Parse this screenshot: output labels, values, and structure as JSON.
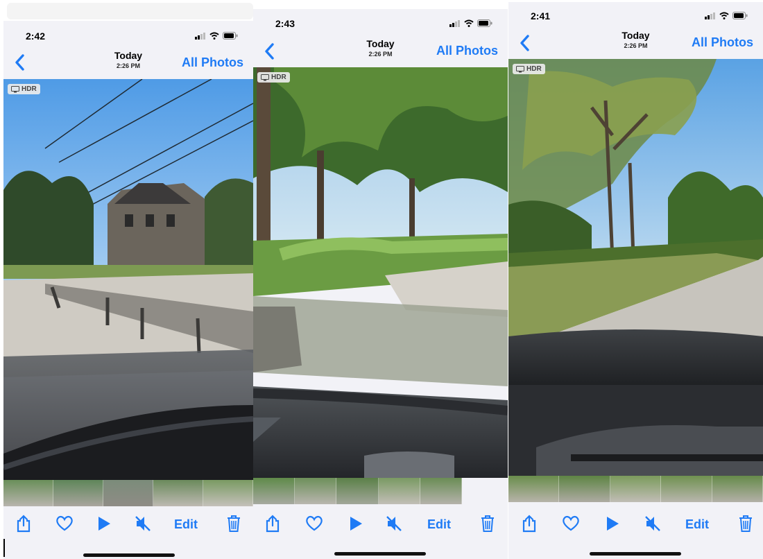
{
  "colors": {
    "accent": "#1f7bf5",
    "icon_blue": "#1f7bf5",
    "sky": "#6fb3ee",
    "grass": "#7a9a4a",
    "road": "#c9c6c0",
    "dash": "#2a2c30"
  },
  "screens": [
    {
      "status_time": "2:42",
      "nav": {
        "title": "Today",
        "subtitle": "2:26 PM",
        "right_link": "All Photos"
      },
      "badge": "HDR",
      "toolbar": {
        "edit": "Edit"
      },
      "icons": [
        "share-icon",
        "heart-icon",
        "play-icon",
        "mute-icon",
        "trash-icon"
      ]
    },
    {
      "status_time": "2:43",
      "nav": {
        "title": "Today",
        "subtitle": "2:26 PM",
        "right_link": "All Photos"
      },
      "badge": "HDR",
      "toolbar": {
        "edit": "Edit"
      },
      "icons": [
        "share-icon",
        "heart-icon",
        "play-icon",
        "mute-icon",
        "trash-icon"
      ]
    },
    {
      "status_time": "2:41",
      "nav": {
        "title": "Today",
        "subtitle": "2:26 PM",
        "right_link": "All Photos"
      },
      "badge": "HDR",
      "toolbar": {
        "edit": "Edit"
      },
      "icons": [
        "share-icon",
        "heart-icon",
        "play-icon",
        "mute-icon",
        "trash-icon"
      ]
    }
  ]
}
